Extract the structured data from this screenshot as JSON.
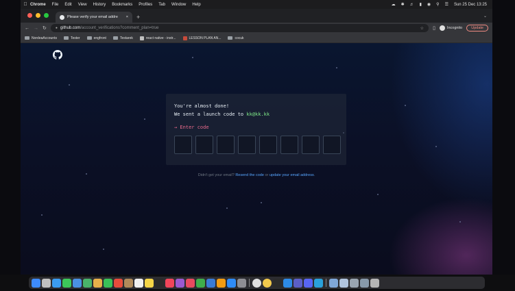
{
  "menubar": {
    "app": "Chrome",
    "items": [
      "File",
      "Edit",
      "View",
      "History",
      "Bookmarks",
      "Profiles",
      "Tab",
      "Window",
      "Help"
    ],
    "clock": "Sun 25 Dec  13:25"
  },
  "browser": {
    "tab_title": "Please verify your email addre",
    "url_host": "github.com",
    "url_path": "/account_verifications?comment_plan=true",
    "incognito_label": "Incognito",
    "update_label": "Update",
    "bookmarks": [
      "NordeaAccounts",
      "Tester",
      "engfront",
      "Testarek",
      "react native - instr...",
      "LESSON PLAN AN...",
      "cocuk"
    ]
  },
  "verify": {
    "line1": "You're almost done!",
    "line2_prefix": "We sent a launch code to ",
    "email": "kk@kk.kk",
    "prompt": "→ Enter code",
    "code_boxes": 8
  },
  "help": {
    "prefix": "Didn't get your email? ",
    "resend": "Resend the code",
    "middle": " or ",
    "update": "update your email address",
    "suffix": "."
  },
  "colors": {
    "accent_green": "#7ee787",
    "prompt_pink": "#ea6a8c",
    "link_blue": "#58a6ff"
  },
  "dock_icons": [
    "finder-icon",
    "launchpad-icon",
    "safari-icon",
    "messages-icon",
    "mail-icon",
    "maps-icon",
    "photos-icon",
    "facetime-icon",
    "calendar-icon",
    "contacts-icon",
    "reminders-icon",
    "notes-icon",
    "tv-icon",
    "music-icon",
    "podcasts-icon",
    "news-icon",
    "numbers-icon",
    "keynote-icon",
    "pages-icon",
    "appstore-icon",
    "settings-icon",
    "chrome-icon",
    "chrome-beta-icon",
    "terminal-icon",
    "vscode-icon",
    "teams-icon",
    "discord-icon",
    "telegram-icon",
    "downloads-icon",
    "folder-icon",
    "folder2-icon",
    "folder3-icon",
    "trash-icon"
  ]
}
